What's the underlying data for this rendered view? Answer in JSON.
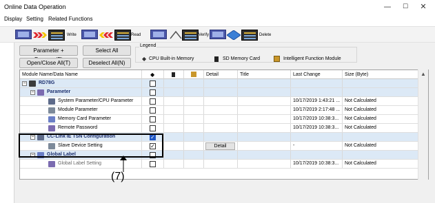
{
  "window": {
    "title": "Online Data Operation",
    "controls": {
      "minimize": "—",
      "maximize": "☐",
      "close": "✕"
    }
  },
  "menu": [
    "Display",
    "Setting",
    "Related Functions"
  ],
  "toolbar": {
    "write_label": "Write",
    "read_label": "Read",
    "verify_label": "Verify",
    "delete_label": "Delete"
  },
  "buttons": {
    "param_program": "Parameter + Program(F)",
    "select_all": "Select All",
    "open_close_all": "Open/Close All(T)",
    "deselect_all": "Deselect All(N)"
  },
  "legend": {
    "title": "Legend",
    "items": [
      "CPU Built-in Memory",
      "SD Memory Card",
      "Intelligent Function Module"
    ]
  },
  "grid": {
    "columns": [
      "Module Name/Data Name",
      "",
      "",
      "",
      "Detail",
      "Title",
      "Last Change",
      "Size (Byte)"
    ],
    "rows": [
      {
        "name": "RD78G",
        "level": 0,
        "bold": true,
        "blue": true,
        "checked": false,
        "detail": "",
        "last_change": "",
        "size": ""
      },
      {
        "name": "Parameter",
        "level": 1,
        "bold": true,
        "blue": true,
        "checked": false,
        "detail": "",
        "last_change": "",
        "size": ""
      },
      {
        "name": "System Parameter/CPU Parameter",
        "level": 2,
        "bold": false,
        "blue": false,
        "checked": false,
        "detail": "",
        "last_change": "10/17/2019 1:43:21 ...",
        "size": "Not Calculated"
      },
      {
        "name": "Module Parameter",
        "level": 2,
        "bold": false,
        "blue": false,
        "checked": false,
        "detail": "",
        "last_change": "10/17/2019 2:17:48 ...",
        "size": "Not Calculated"
      },
      {
        "name": "Memory Card Parameter",
        "level": 2,
        "bold": false,
        "blue": false,
        "checked": false,
        "detail": "",
        "last_change": "10/17/2019 10:38:3...",
        "size": "Not Calculated"
      },
      {
        "name": "Remote Password",
        "level": 2,
        "bold": false,
        "blue": false,
        "checked": false,
        "detail": "",
        "last_change": "10/17/2019 10:38:3...",
        "size": "Not Calculated"
      },
      {
        "name": "CC-Link IE TSN Configuration",
        "level": 1,
        "bold": true,
        "blue": true,
        "checked": true,
        "detail": "",
        "last_change": "",
        "size": ""
      },
      {
        "name": "Slave Device Setting",
        "level": 2,
        "bold": false,
        "blue": false,
        "checked": true,
        "detail": "Detail",
        "last_change": "-",
        "size": "Not Calculated"
      },
      {
        "name": "Global Label",
        "level": 1,
        "bold": true,
        "blue": true,
        "checked": false,
        "detail": "",
        "last_change": "",
        "size": ""
      },
      {
        "name": "Global Label Setting",
        "level": 2,
        "bold": false,
        "blue": false,
        "checked": false,
        "detail": "",
        "last_change": "10/17/2019 10:38:3...",
        "size": "Not Calculated"
      }
    ]
  },
  "annotation": {
    "label": "(7)"
  }
}
